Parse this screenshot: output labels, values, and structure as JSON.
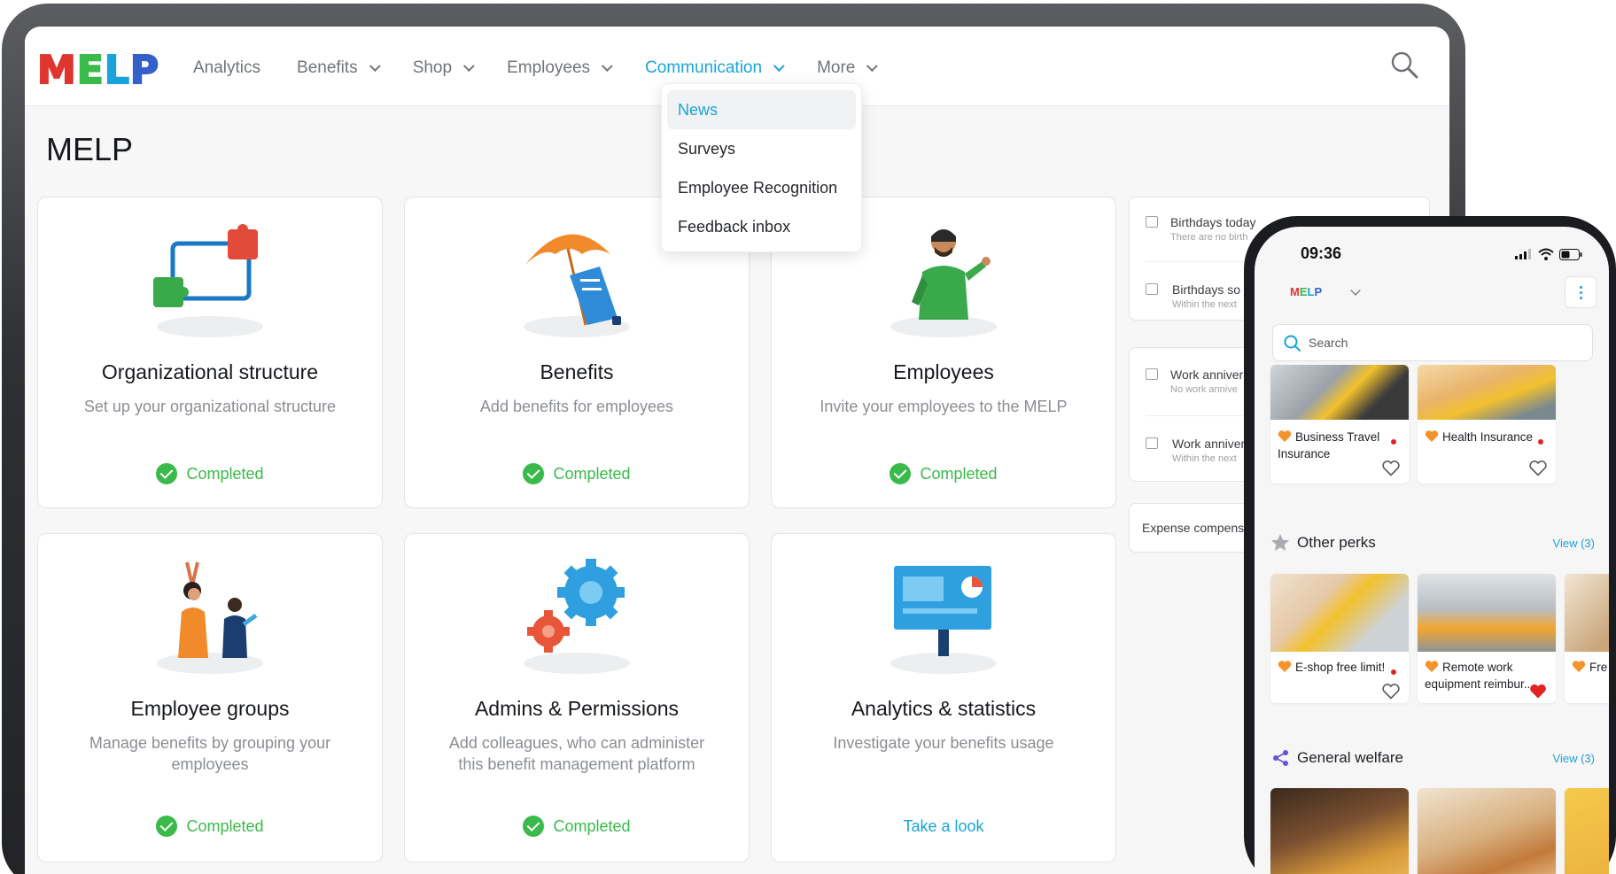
{
  "app": {
    "logo_text": "MELP",
    "nav": [
      {
        "label": "Analytics",
        "has_menu": false
      },
      {
        "label": "Benefits",
        "has_menu": true
      },
      {
        "label": "Shop",
        "has_menu": true
      },
      {
        "label": "Employees",
        "has_menu": true
      },
      {
        "label": "Communication",
        "has_menu": true,
        "active": true
      },
      {
        "label": "More",
        "has_menu": true
      }
    ],
    "search_icon": "search-icon"
  },
  "dropdown": {
    "items": [
      "News",
      "Surveys",
      "Employee Recognition",
      "Feedback inbox"
    ],
    "active": "News"
  },
  "page": {
    "title": "MELP"
  },
  "cards": [
    {
      "title": "Organizational structure",
      "desc": "Set up your organizational structure",
      "status": "Completed"
    },
    {
      "title": "Benefits",
      "desc": "Add benefits for employees",
      "status": "Completed"
    },
    {
      "title": "Employees",
      "desc": "Invite your employees to the MELP",
      "status": "Completed"
    },
    {
      "title": "Employee groups",
      "desc": "Manage benefits by grouping your employees",
      "status": "Completed"
    },
    {
      "title": "Admins & Permissions",
      "desc": "Add colleagues, who can administer this benefit management platform",
      "status": "Completed"
    },
    {
      "title": "Analytics & statistics",
      "desc": "Investigate your benefits usage",
      "link": "Take a look"
    }
  ],
  "side": {
    "birthdays_today": {
      "label": "Birthdays today",
      "sub": "There are no birth"
    },
    "birthdays_soon": {
      "label": "Birthdays so",
      "sub": "Within the next"
    },
    "work_anniv_today": {
      "label": "Work anniver",
      "sub": "No work annive"
    },
    "work_anniv_soon": {
      "label": "Work anniver",
      "sub": "Within the next"
    },
    "expense": {
      "label": "Expense compens"
    }
  },
  "phone": {
    "time": "09:36",
    "logo_text": "MELP",
    "search_placeholder": "Search",
    "top_perks": [
      {
        "name": "Business Travel Insurance",
        "liked": false
      },
      {
        "name": "Health Insurance",
        "liked": false
      }
    ],
    "other_perks": {
      "title": "Other perks",
      "view": "View (3)",
      "items": [
        {
          "name": "E-shop free limit!",
          "liked": false
        },
        {
          "name": "Remote work equipment reimbur...",
          "liked": true
        },
        {
          "name": "Fre",
          "liked": false
        }
      ]
    },
    "general_welfare": {
      "title": "General welfare",
      "view": "View (3)"
    }
  },
  "colors": {
    "accent": "#1aa3d8",
    "success": "#3aba4a",
    "like": "#e02424",
    "perk_heart": "#f5922a"
  }
}
